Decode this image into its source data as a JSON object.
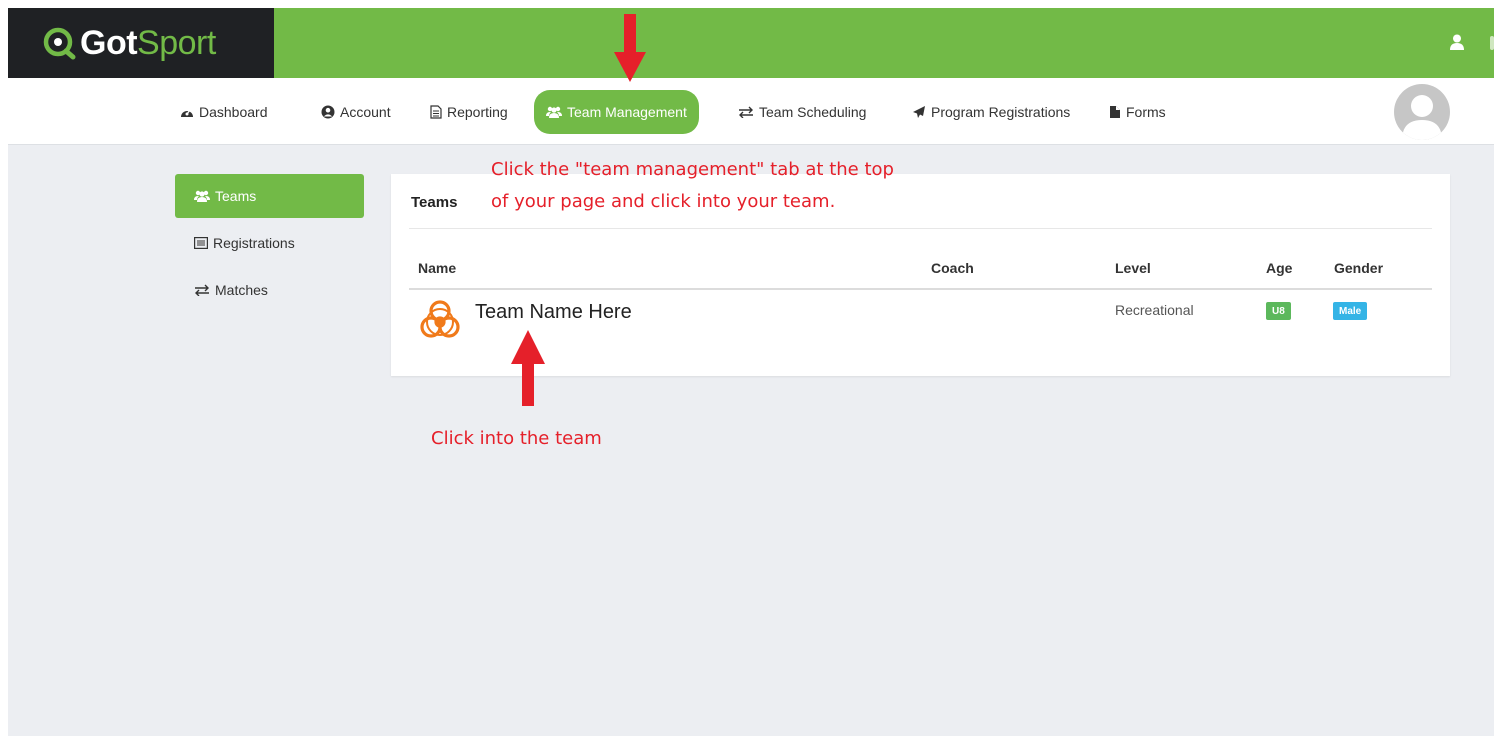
{
  "header": {
    "logo_got": "Got",
    "logo_sport": "Sport"
  },
  "nav": {
    "items": [
      {
        "label": "Dashboard",
        "icon": "dashboard-icon"
      },
      {
        "label": "Account",
        "icon": "user-circle-icon"
      },
      {
        "label": "Reporting",
        "icon": "document-icon"
      },
      {
        "label": "Team Management",
        "icon": "users-icon",
        "active": true
      },
      {
        "label": "Team Scheduling",
        "icon": "exchange-icon"
      },
      {
        "label": "Program Registrations",
        "icon": "paper-plane-icon"
      },
      {
        "label": "Forms",
        "icon": "file-icon"
      }
    ]
  },
  "sidebar": {
    "items": [
      {
        "label": "Teams",
        "icon": "users-icon",
        "active": true
      },
      {
        "label": "Registrations",
        "icon": "list-alt-icon"
      },
      {
        "label": "Matches",
        "icon": "exchange-icon"
      }
    ]
  },
  "main": {
    "title": "Teams",
    "columns": [
      "Name",
      "Coach",
      "Level",
      "Age",
      "Gender"
    ],
    "rows": [
      {
        "name": "Team Name Here",
        "coach": "",
        "level": "Recreational",
        "age": "U8",
        "gender": "Male"
      }
    ]
  },
  "annotations": {
    "top_note_line1": "Click the \"team management\" tab at the top",
    "top_note_line2": "of your page and click into your team.",
    "bottom_note": "Click into the team"
  },
  "colors": {
    "brand_green": "#72ba47",
    "logo_bg": "#1f2124",
    "annotation_red": "#e5202a",
    "age_badge": "#5cb85c",
    "gender_badge": "#34b4e6"
  }
}
